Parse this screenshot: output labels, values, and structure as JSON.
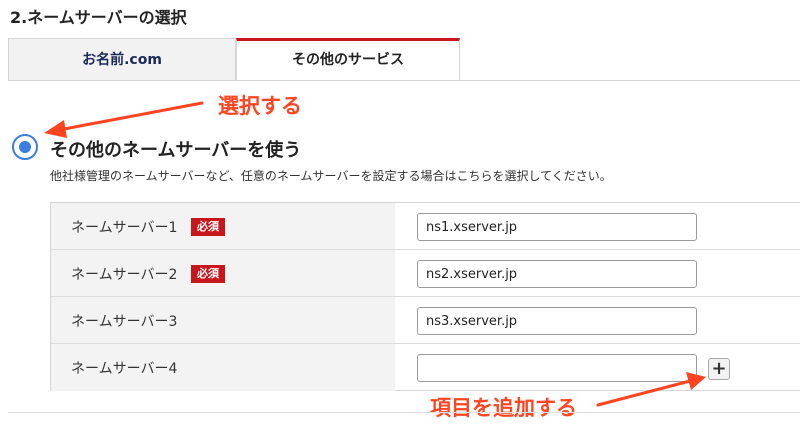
{
  "section_title": "2.ネームサーバーの選択",
  "tabs": [
    {
      "label": "お名前.com",
      "active": false
    },
    {
      "label": "その他のサービス",
      "active": true
    }
  ],
  "annotations": {
    "select": "選択する",
    "add_item": "項目を追加する",
    "color": "#ff4422"
  },
  "option": {
    "label": "その他のネームサーバーを使う",
    "description": "他社様管理のネームサーバーなど、任意のネームサーバーを設定する場合はこちらを選択してください。",
    "selected": true
  },
  "nameservers": [
    {
      "label": "ネームサーバー1",
      "required": true,
      "badge": "必須",
      "value": "ns1.xserver.jp"
    },
    {
      "label": "ネームサーバー2",
      "required": true,
      "badge": "必須",
      "value": "ns2.xserver.jp"
    },
    {
      "label": "ネームサーバー3",
      "required": false,
      "value": "ns3.xserver.jp"
    },
    {
      "label": "ネームサーバー4",
      "required": false,
      "value": ""
    }
  ],
  "add_button": {
    "label": "+",
    "icon": "plus-icon"
  },
  "colors": {
    "accent_red": "#c8161d",
    "radio_blue": "#3b7de0",
    "tab_text_navy": "#1a2a5a"
  }
}
